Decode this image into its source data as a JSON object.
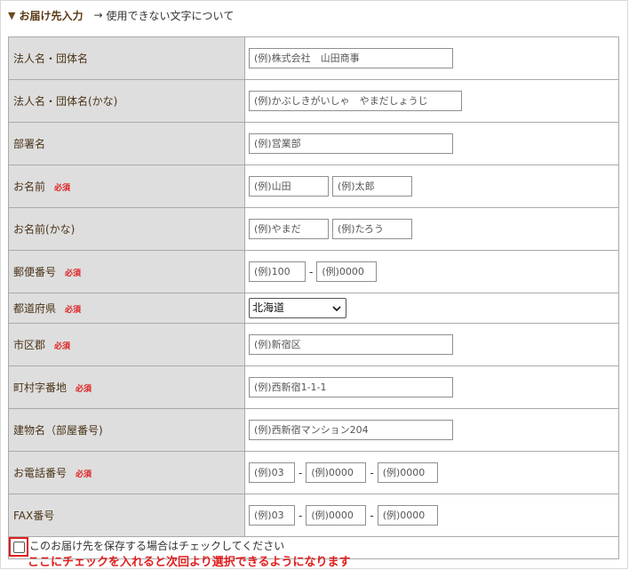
{
  "header": {
    "title": "お届け先入力",
    "arrow": "→",
    "link": "使用できない文字について"
  },
  "required_badge": "必須",
  "rows": {
    "company": {
      "label": "法人名・団体名",
      "placeholder": "(例)株式会社　山田商事"
    },
    "company_kana": {
      "label": "法人名・団体名(かな)",
      "placeholder": "(例)かぶしきがいしゃ　やまだしょうじ"
    },
    "department": {
      "label": "部署名",
      "placeholder": "(例)営業部"
    },
    "name": {
      "label": "お名前",
      "placeholder_last": "(例)山田",
      "placeholder_first": "(例)太郎"
    },
    "name_kana": {
      "label": "お名前(かな)",
      "placeholder_last": "(例)やまだ",
      "placeholder_first": "(例)たろう"
    },
    "postal": {
      "label": "郵便番号",
      "placeholder1": "(例)100",
      "placeholder2": "(例)0000",
      "separator": "-"
    },
    "prefecture": {
      "label": "都道府県",
      "selected": "北海道"
    },
    "city": {
      "label": "市区郡",
      "placeholder": "(例)新宿区"
    },
    "town": {
      "label": "町村字番地",
      "placeholder": "(例)西新宿1-1-1"
    },
    "building": {
      "label": "建物名（部屋番号)",
      "placeholder": "(例)西新宿マンション204"
    },
    "phone": {
      "label": "お電話番号",
      "placeholder1": "(例)03",
      "placeholder2": "(例)0000",
      "placeholder3": "(例)0000",
      "separator": "-"
    },
    "fax": {
      "label": "FAX番号",
      "placeholder1": "(例)03",
      "placeholder2": "(例)0000",
      "placeholder3": "(例)0000",
      "separator": "-"
    }
  },
  "save": {
    "label": "このお届け先を保存する場合はチェックしてください",
    "note": "ここにチェックを入れると次回より選択できるようになります"
  },
  "colors": {
    "required": "#e01e1e",
    "label_bg": "#dedede",
    "header_text": "#5a3a14"
  }
}
